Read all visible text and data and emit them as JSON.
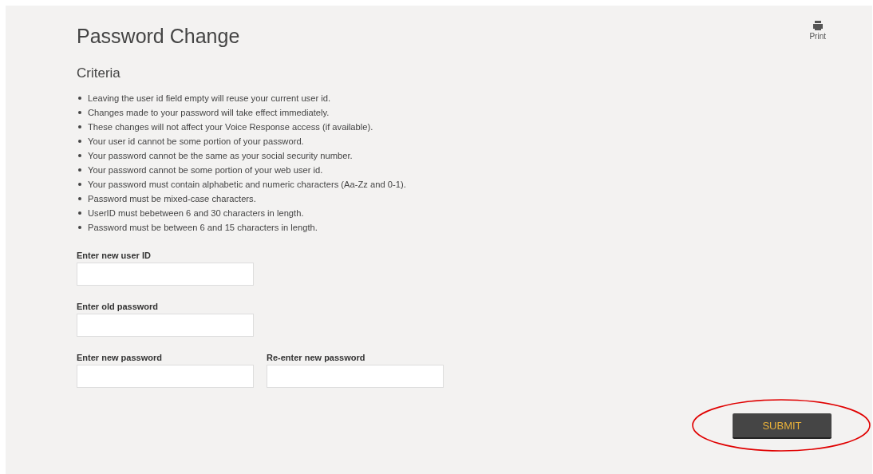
{
  "page": {
    "title": "Password Change",
    "print_label": "Print"
  },
  "criteria": {
    "heading": "Criteria",
    "items": [
      "Leaving the user id field empty will reuse your current user id.",
      "Changes made to your password will take effect immediately.",
      "These changes will not affect your Voice Response access (if available).",
      "Your user id cannot be some portion of your password.",
      "Your password cannot be the same as your social security number.",
      "Your password cannot be some portion of your web user id.",
      "Your password must contain alphabetic and numeric characters (Aa-Zz and 0-1).",
      "Password must be mixed-case characters.",
      "UserID must bebetween 6 and 30 characters in length.",
      "Password must be between 6 and 15 characters in length."
    ]
  },
  "form_rows": [
    [
      {
        "label": "Enter new user ID"
      }
    ],
    [
      {
        "label": "Enter old password"
      }
    ],
    [
      {
        "label": "Enter new password"
      },
      {
        "label": "Re-enter new password"
      }
    ]
  ],
  "submit_button": {
    "label": "SUBMIT",
    "highlighted": true
  }
}
